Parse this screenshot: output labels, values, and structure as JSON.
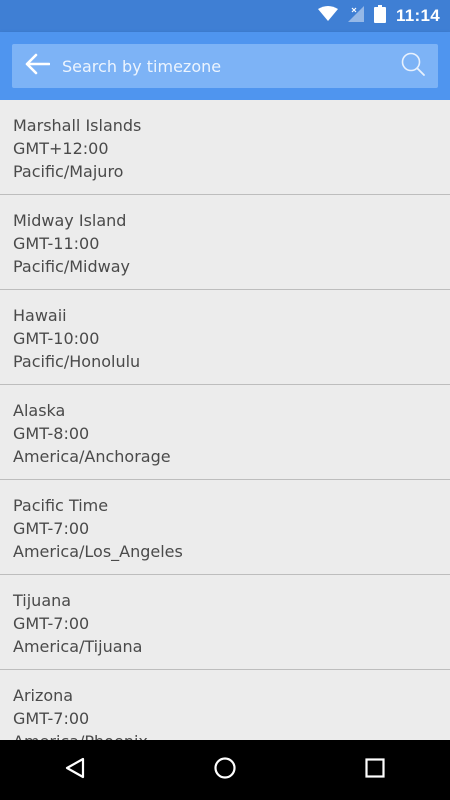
{
  "status_bar": {
    "time": "11:14",
    "icons": [
      "wifi-icon",
      "signal-icon",
      "battery-icon"
    ]
  },
  "search": {
    "placeholder": "Search by timezone",
    "value": ""
  },
  "timezones": [
    {
      "name": "Marshall Islands",
      "offset": "GMT+12:00",
      "id": "Pacific/Majuro"
    },
    {
      "name": "Midway Island",
      "offset": "GMT-11:00",
      "id": "Pacific/Midway"
    },
    {
      "name": "Hawaii",
      "offset": "GMT-10:00",
      "id": "Pacific/Honolulu"
    },
    {
      "name": "Alaska",
      "offset": "GMT-8:00",
      "id": "America/Anchorage"
    },
    {
      "name": "Pacific Time",
      "offset": "GMT-7:00",
      "id": "America/Los_Angeles"
    },
    {
      "name": "Tijuana",
      "offset": "GMT-7:00",
      "id": "America/Tijuana"
    },
    {
      "name": "Arizona",
      "offset": "GMT-7:00",
      "id": "America/Phoenix"
    }
  ],
  "colors": {
    "status_bar": "#3f7fd4",
    "app_bar": "#4f95ef",
    "search_box": "#7db3f6",
    "list_background": "#ececec",
    "list_text": "#4a4a4a",
    "nav_bar": "#000000"
  },
  "nav_bar": {
    "icons": [
      "back-triangle-icon",
      "home-circle-icon",
      "recents-square-icon"
    ]
  }
}
